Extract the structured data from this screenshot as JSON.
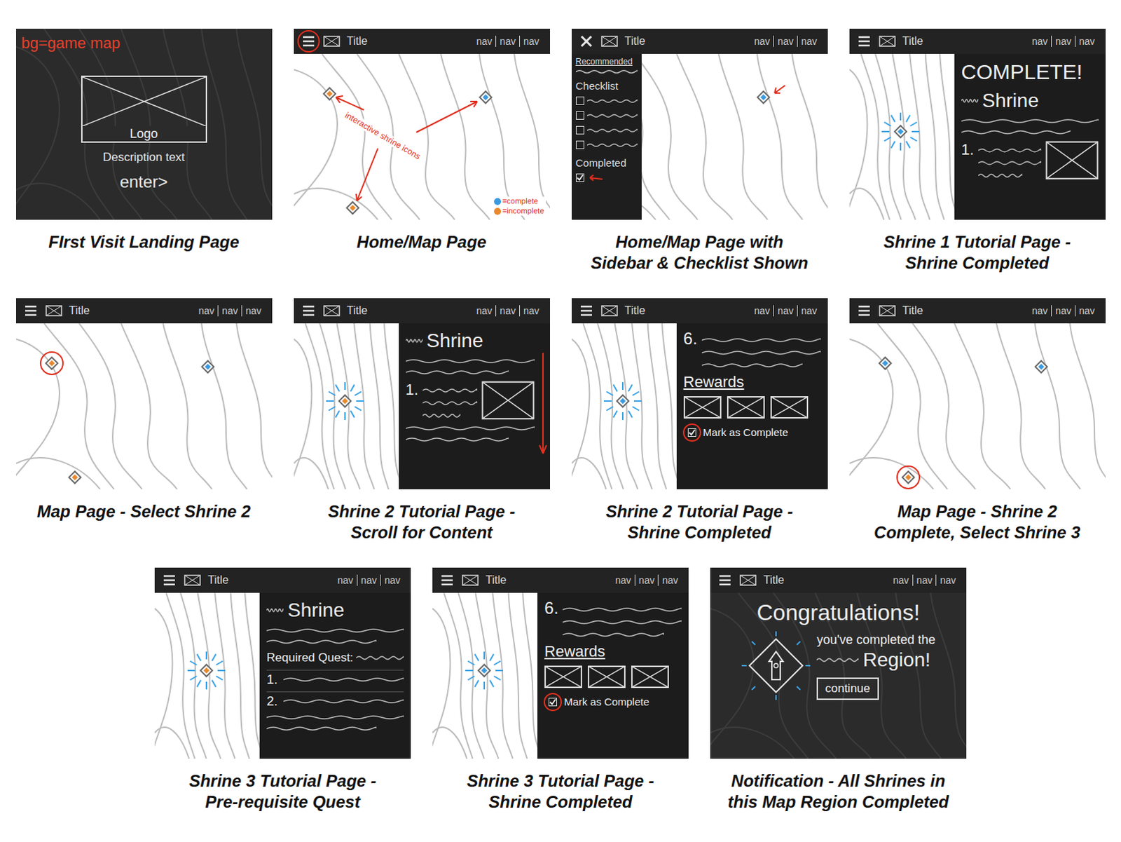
{
  "panels": [
    {
      "kind": "landing",
      "caption": [
        "FIrst Visit Landing Page"
      ],
      "note": "bg=game map",
      "logo": "Logo",
      "description": "Description text",
      "enter": "enter>"
    },
    {
      "kind": "map",
      "caption": [
        "Home/Map Page"
      ],
      "header": {
        "title": "Title",
        "nav": [
          "nav",
          "nav",
          "nav"
        ],
        "menu_open": false,
        "menu_circled": true
      },
      "pins": [
        {
          "status": "incomplete",
          "color": "#e8892e",
          "circled": false,
          "glowing": false,
          "annotated": false
        },
        {
          "status": "complete",
          "color": "#3b9be0",
          "circled": false,
          "glowing": false,
          "annotated": false
        },
        {
          "status": "incomplete",
          "color": "#e8892e",
          "circled": false,
          "glowing": false,
          "annotated": false
        }
      ],
      "annotation": "interactive shrine icons",
      "legend": [
        {
          "label": "=complete",
          "color": "#3b9be0"
        },
        {
          "label": "=incomplete",
          "color": "#e8892e"
        }
      ]
    },
    {
      "kind": "map-sidebar",
      "caption": [
        "Home/Map Page with",
        "Sidebar & Checklist Shown"
      ],
      "header": {
        "title": "Title",
        "nav": [
          "nav",
          "nav",
          "nav"
        ],
        "menu_open": true,
        "menu_circled": false
      },
      "pins": [
        {
          "status": "complete",
          "color": "#3b9be0",
          "circled": false,
          "glowing": false,
          "annotated": true
        }
      ],
      "sidebar": {
        "recommended": "Recommended",
        "checklist": "Checklist",
        "checklist_items": [
          {
            "checked": false
          },
          {
            "checked": false
          },
          {
            "checked": false
          },
          {
            "checked": false
          }
        ],
        "completed": "Completed",
        "completed_items": [
          {
            "checked": true,
            "annotated": true
          }
        ]
      }
    },
    {
      "kind": "detail",
      "caption": [
        "Shrine 1 Tutorial Page -",
        "Shrine Completed"
      ],
      "header": {
        "title": "Title",
        "nav": [
          "nav",
          "nav",
          "nav"
        ],
        "menu_open": false,
        "menu_circled": false
      },
      "pins": [
        {
          "status": "complete",
          "color": "#3b9be0",
          "circled": false,
          "glowing": true,
          "annotated": false
        }
      ],
      "scroll_hint": false,
      "blocks": [
        {
          "kind": "banner",
          "text": "COMPLETE!"
        },
        {
          "kind": "title",
          "text": "Shrine"
        },
        {
          "kind": "scribble"
        },
        {
          "kind": "step-image",
          "text": "1."
        }
      ]
    },
    {
      "kind": "map",
      "caption": [
        "Map Page - Select Shrine 2"
      ],
      "header": {
        "title": "Title",
        "nav": [
          "nav",
          "nav",
          "nav"
        ],
        "menu_open": false,
        "menu_circled": false
      },
      "pins": [
        {
          "status": "incomplete",
          "color": "#e8892e",
          "circled": true,
          "glowing": false,
          "annotated": false
        },
        {
          "status": "complete",
          "color": "#3b9be0",
          "circled": false,
          "glowing": false,
          "annotated": false
        },
        {
          "status": "incomplete",
          "color": "#e8892e",
          "circled": false,
          "glowing": false,
          "annotated": false
        }
      ]
    },
    {
      "kind": "detail",
      "caption": [
        "Shrine 2 Tutorial Page -",
        "Scroll for Content"
      ],
      "header": {
        "title": "Title",
        "nav": [
          "nav",
          "nav",
          "nav"
        ],
        "menu_open": false,
        "menu_circled": false
      },
      "pins": [
        {
          "status": "incomplete",
          "color": "#e8892e",
          "circled": false,
          "glowing": true,
          "annotated": false
        }
      ],
      "scroll_hint": true,
      "blocks": [
        {
          "kind": "title",
          "text": "Shrine"
        },
        {
          "kind": "scribble"
        },
        {
          "kind": "step-image",
          "text": "1."
        },
        {
          "kind": "scribble"
        }
      ]
    },
    {
      "kind": "detail",
      "caption": [
        "Shrine 2 Tutorial Page -",
        "Shrine Completed"
      ],
      "header": {
        "title": "Title",
        "nav": [
          "nav",
          "nav",
          "nav"
        ],
        "menu_open": false,
        "menu_circled": false
      },
      "pins": [
        {
          "status": "complete",
          "color": "#3b9be0",
          "circled": false,
          "glowing": true,
          "annotated": false
        }
      ],
      "scroll_hint": false,
      "blocks": [
        {
          "kind": "step",
          "text": "6."
        },
        {
          "kind": "rewards",
          "text": "Rewards"
        },
        {
          "kind": "checkbox",
          "text": "Mark as Complete",
          "checked": true,
          "circled": true
        }
      ]
    },
    {
      "kind": "map",
      "caption": [
        "Map Page - Shrine 2",
        "Complete, Select Shrine 3"
      ],
      "header": {
        "title": "Title",
        "nav": [
          "nav",
          "nav",
          "nav"
        ],
        "menu_open": false,
        "menu_circled": false
      },
      "pins": [
        {
          "status": "complete",
          "color": "#3b9be0",
          "circled": false,
          "glowing": false,
          "annotated": false
        },
        {
          "status": "complete",
          "color": "#3b9be0",
          "circled": false,
          "glowing": false,
          "annotated": false
        },
        {
          "status": "incomplete",
          "color": "#e8892e",
          "circled": true,
          "glowing": false,
          "annotated": false
        }
      ]
    },
    {
      "kind": "detail",
      "caption": [
        "Shrine 3 Tutorial Page -",
        "Pre-requisite Quest"
      ],
      "header": {
        "title": "Title",
        "nav": [
          "nav",
          "nav",
          "nav"
        ],
        "menu_open": false,
        "menu_circled": false
      },
      "pins": [
        {
          "status": "incomplete",
          "color": "#e8892e",
          "circled": false,
          "glowing": true,
          "annotated": false
        }
      ],
      "scroll_hint": false,
      "blocks": [
        {
          "kind": "title",
          "text": "Shrine"
        },
        {
          "kind": "scribble"
        },
        {
          "kind": "label-line",
          "text": "Required Quest:"
        },
        {
          "kind": "numbered",
          "text": "1."
        },
        {
          "kind": "numbered",
          "text": "2."
        },
        {
          "kind": "scribble"
        }
      ]
    },
    {
      "kind": "detail",
      "caption": [
        "Shrine 3 Tutorial Page -",
        "Shrine Completed"
      ],
      "header": {
        "title": "Title",
        "nav": [
          "nav",
          "nav",
          "nav"
        ],
        "menu_open": false,
        "menu_circled": false
      },
      "pins": [
        {
          "status": "complete",
          "color": "#3b9be0",
          "circled": false,
          "glowing": true,
          "annotated": false
        }
      ],
      "scroll_hint": false,
      "blocks": [
        {
          "kind": "step",
          "text": "6."
        },
        {
          "kind": "rewards",
          "text": "Rewards"
        },
        {
          "kind": "checkbox",
          "text": "Mark as Complete",
          "checked": true,
          "circled": true
        }
      ]
    },
    {
      "kind": "congrats",
      "caption": [
        "Notification - All Shrines in",
        "this Map Region Completed"
      ],
      "header": {
        "title": "Title",
        "nav": [
          "nav",
          "nav",
          "nav"
        ],
        "menu_open": false,
        "menu_circled": false
      },
      "title": "Congratulations!",
      "line1": "you've completed the",
      "line2": "Region!",
      "button": "continue"
    }
  ]
}
